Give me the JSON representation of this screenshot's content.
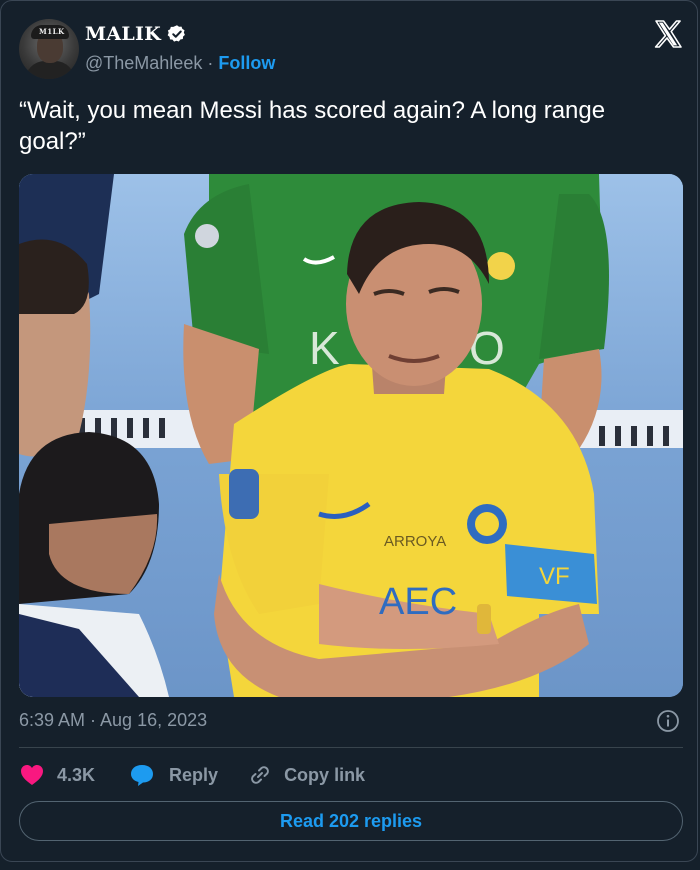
{
  "author": {
    "name": "MALIK",
    "handle": "@TheMahleek",
    "follow_label": "Follow",
    "verified": true,
    "avatar_cap_text": "M1LK"
  },
  "tweet": {
    "text": "“Wait, you mean Messi has scored again? A long range goal?”",
    "timestamp": "6:39 AM · Aug 16, 2023"
  },
  "media": {
    "jersey_sponsor": "ARROYA",
    "armband_text": "VF",
    "background_shirt_letters": "K",
    "background_shirt_letters_right": "O",
    "shirt_number_partial": "AEC"
  },
  "actions": {
    "like_count": "4.3K",
    "reply_label": "Reply",
    "copy_link_label": "Copy link",
    "read_replies_label": "Read 202 replies"
  },
  "icons": {
    "verified": "verified-badge-icon",
    "x_logo": "x-logo-icon",
    "info": "info-icon",
    "like": "heart-icon",
    "reply": "speech-bubble-icon",
    "copy": "link-icon"
  },
  "colors": {
    "background": "#15202b",
    "accent": "#1d9bf0",
    "like": "#f91880",
    "muted": "#8b98a5"
  }
}
